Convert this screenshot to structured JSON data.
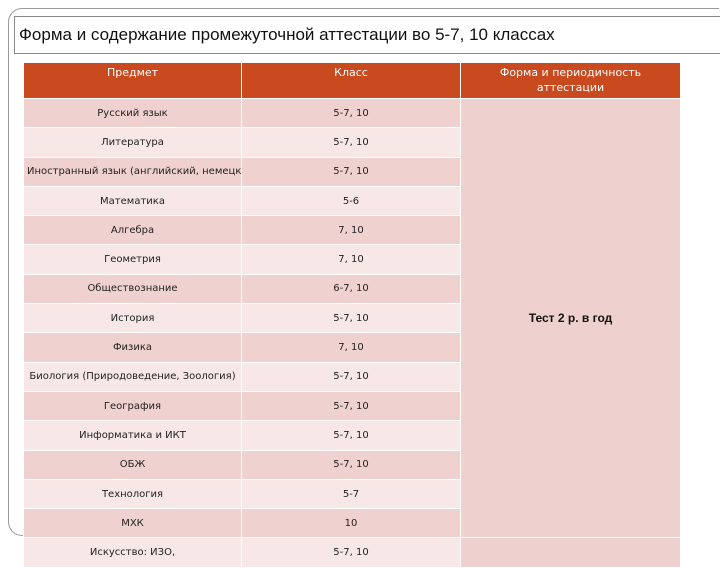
{
  "slide": {
    "title": "Форма и содержание промежуточной аттестации во 5-7, 10 классах"
  },
  "table": {
    "headers": {
      "subject": "Предмет",
      "grade": "Класс",
      "form": "Форма и периодичность аттестации"
    },
    "merged_form_value": "Тест 2 р. в год",
    "rows": [
      {
        "subject": "Русский язык",
        "grade": "5-7, 10"
      },
      {
        "subject": "Литература",
        "grade": "5-7, 10"
      },
      {
        "subject": "Иностранный язык (английский, немецкий)",
        "grade": "5-7, 10"
      },
      {
        "subject": "Математика",
        "grade": "5-6"
      },
      {
        "subject": "Алгебра",
        "grade": "7, 10"
      },
      {
        "subject": "Геометрия",
        "grade": "7, 10"
      },
      {
        "subject": "Обществознание",
        "grade": "6-7, 10"
      },
      {
        "subject": "История",
        "grade": "5-7, 10"
      },
      {
        "subject": "Физика",
        "grade": "7, 10"
      },
      {
        "subject": "Биология (Природоведение, Зоология)",
        "grade": "5-7, 10"
      },
      {
        "subject": "География",
        "grade": "5-7, 10"
      },
      {
        "subject": "Информатика и ИКТ",
        "grade": "5-7, 10"
      },
      {
        "subject": "ОБЖ",
        "grade": "5-7, 10"
      },
      {
        "subject": "Технология",
        "grade": "5-7"
      },
      {
        "subject": "МХК",
        "grade": "10"
      },
      {
        "subject": "Искусство: ИЗО, ",
        "grade": "5-7, 10"
      }
    ]
  },
  "colors": {
    "header_bg": "#c94a1f",
    "row_odd": "#efd1cf",
    "row_even": "#f7e8e7"
  }
}
